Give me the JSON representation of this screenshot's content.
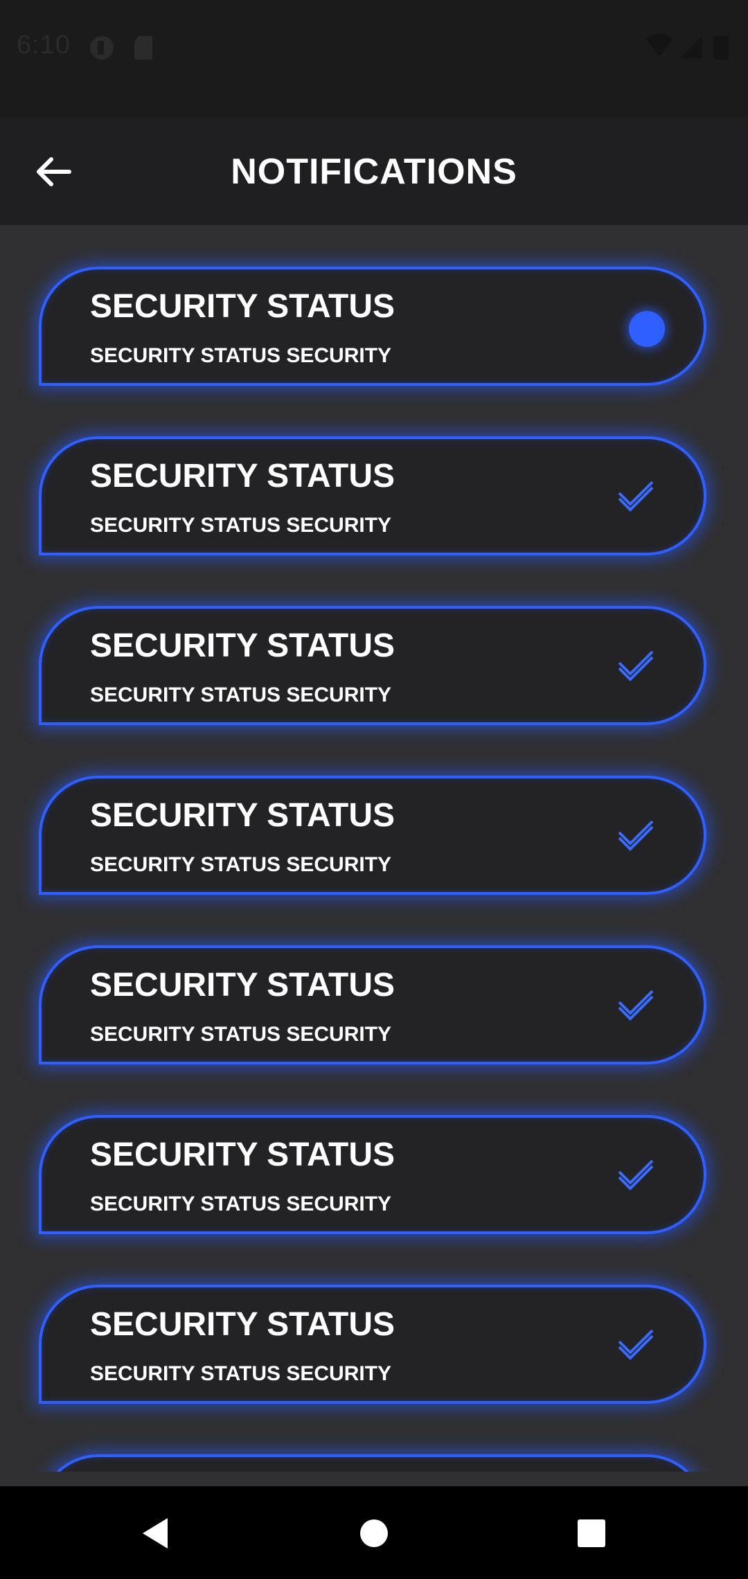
{
  "status_bar": {
    "time": "6:10"
  },
  "app_bar": {
    "title": "NOTIFICATIONS",
    "back_icon": "arrow-left-icon"
  },
  "notifications": [
    {
      "title": "SECURITY STATUS",
      "subtitle": "SECURITY STATUS SECURITY",
      "state": "unread"
    },
    {
      "title": "SECURITY STATUS",
      "subtitle": "SECURITY STATUS SECURITY",
      "state": "read"
    },
    {
      "title": "SECURITY STATUS",
      "subtitle": "SECURITY STATUS SECURITY",
      "state": "read"
    },
    {
      "title": "SECURITY STATUS",
      "subtitle": "SECURITY STATUS SECURITY",
      "state": "read"
    },
    {
      "title": "SECURITY STATUS",
      "subtitle": "SECURITY STATUS SECURITY",
      "state": "read"
    },
    {
      "title": "SECURITY STATUS",
      "subtitle": "SECURITY STATUS SECURITY",
      "state": "read"
    },
    {
      "title": "SECURITY STATUS",
      "subtitle": "SECURITY STATUS SECURITY",
      "state": "read"
    },
    {
      "title": "",
      "subtitle": "",
      "state": "partial"
    }
  ],
  "colors": {
    "accent": "#2f5fff",
    "card_bg": "#232326",
    "screen_bg": "#303033",
    "app_bar_bg": "#1f1f21"
  },
  "nav_bar": {
    "back_icon": "triangle-back-icon",
    "home_icon": "circle-home-icon",
    "recents_icon": "square-recents-icon"
  }
}
